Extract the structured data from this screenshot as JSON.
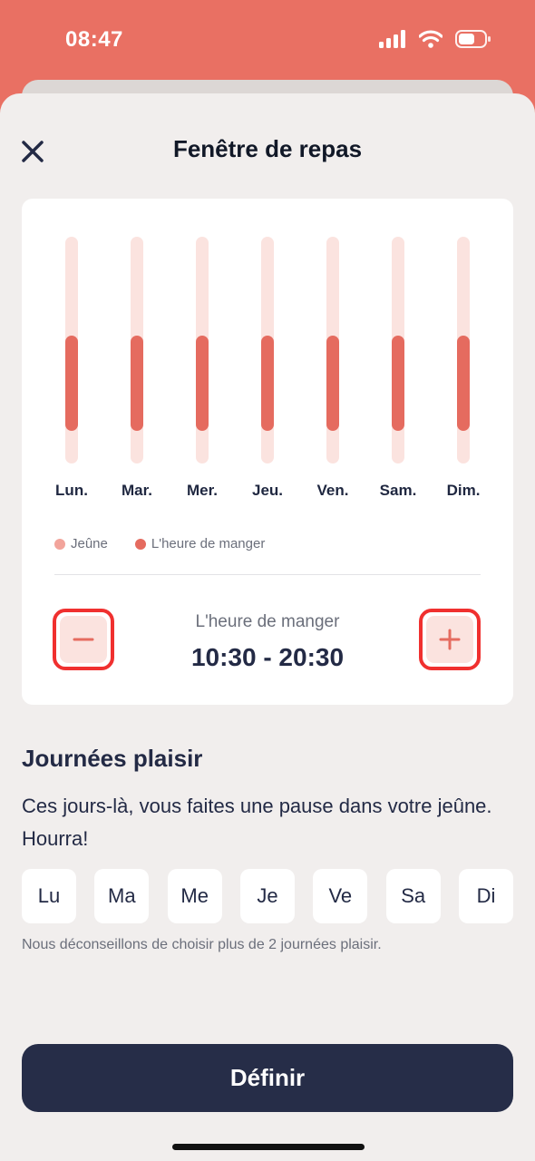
{
  "status_bar": {
    "time": "08:47"
  },
  "header": {
    "title": "Fenêtre de repas"
  },
  "chart_data": {
    "type": "bar",
    "categories": [
      "Lun.",
      "Mar.",
      "Mer.",
      "Jeu.",
      "Ven.",
      "Sam.",
      "Dim."
    ],
    "series": [
      {
        "name": "Jeûne",
        "color": "#fbe3df"
      },
      {
        "name": "L'heure de manger",
        "color": "#e56b5f",
        "start": "10:30",
        "end": "20:30"
      }
    ],
    "y_range_hours": [
      0,
      24
    ]
  },
  "legend": {
    "fasting": "Jeûne",
    "eating": "L'heure de manger"
  },
  "eating_window": {
    "label": "L'heure de manger",
    "range": "10:30 - 20:30"
  },
  "cheat_days": {
    "title": "Journées plaisir",
    "description": "Ces jours-là, vous faites une pause dans votre jeûne. Hourra!",
    "days": [
      "Lu",
      "Ma",
      "Me",
      "Je",
      "Ve",
      "Sa",
      "Di"
    ],
    "note": "Nous déconseillons de choisir plus de 2 journées plaisir."
  },
  "cta": {
    "label": "Définir"
  },
  "colors": {
    "accent": "#e56b5f",
    "dark": "#262d48",
    "light_accent": "#fbe3df",
    "highlight": "#f0302f"
  }
}
